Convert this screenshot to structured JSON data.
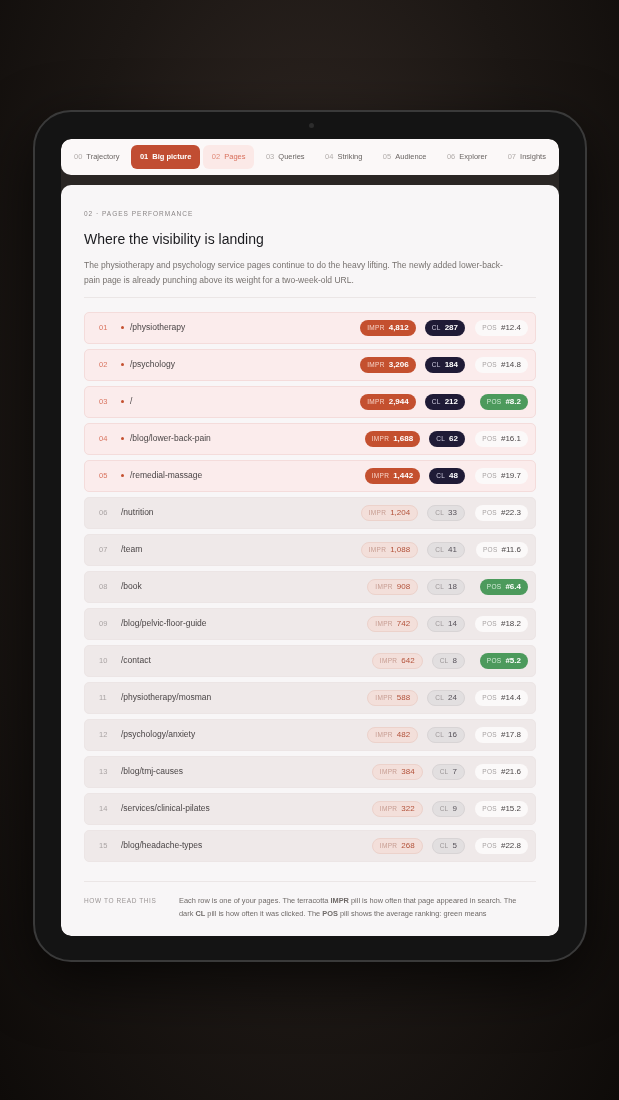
{
  "tabs": [
    {
      "number": "00",
      "label": "Trajectory",
      "selected": false,
      "current": false
    },
    {
      "number": "01",
      "label": "Big picture",
      "selected": true,
      "current": false
    },
    {
      "number": "02",
      "label": "Pages",
      "selected": false,
      "current": true
    },
    {
      "number": "03",
      "label": "Queries",
      "selected": false,
      "current": false
    },
    {
      "number": "04",
      "label": "Striking",
      "selected": false,
      "current": false
    },
    {
      "number": "05",
      "label": "Audience",
      "selected": false,
      "current": false
    },
    {
      "number": "06",
      "label": "Explorer",
      "selected": false,
      "current": false
    },
    {
      "number": "07",
      "label": "Insights",
      "selected": false,
      "current": false
    }
  ],
  "section": {
    "eyebrow": "02 · PAGES PERFORMANCE",
    "title": "Where the visibility is landing",
    "description": "The physiotherapy and psychology service pages continue to do the heavy lifting. The newly added lower-back-pain page is already punching above its weight for a two-week-old URL."
  },
  "rows": [
    {
      "rank": "01",
      "path": "/physiotherapy",
      "highlighted": true,
      "impr": {
        "label": "IMPR",
        "value": "4,812"
      },
      "cl": {
        "label": "CL",
        "value": "287"
      },
      "pos": {
        "label": "POS",
        "value": "#12.4",
        "good": false
      }
    },
    {
      "rank": "02",
      "path": "/psychology",
      "highlighted": true,
      "impr": {
        "label": "IMPR",
        "value": "3,206"
      },
      "cl": {
        "label": "CL",
        "value": "184"
      },
      "pos": {
        "label": "POS",
        "value": "#14.8",
        "good": false
      }
    },
    {
      "rank": "03",
      "path": "/",
      "highlighted": true,
      "impr": {
        "label": "IMPR",
        "value": "2,944"
      },
      "cl": {
        "label": "CL",
        "value": "212"
      },
      "pos": {
        "label": "POS",
        "value": "#8.2",
        "good": true
      }
    },
    {
      "rank": "04",
      "path": "/blog/lower-back-pain",
      "highlighted": true,
      "impr": {
        "label": "IMPR",
        "value": "1,688"
      },
      "cl": {
        "label": "CL",
        "value": "62"
      },
      "pos": {
        "label": "POS",
        "value": "#16.1",
        "good": false
      }
    },
    {
      "rank": "05",
      "path": "/remedial-massage",
      "highlighted": true,
      "impr": {
        "label": "IMPR",
        "value": "1,442"
      },
      "cl": {
        "label": "CL",
        "value": "48"
      },
      "pos": {
        "label": "POS",
        "value": "#19.7",
        "good": false
      }
    },
    {
      "rank": "06",
      "path": "/nutrition",
      "highlighted": false,
      "impr": {
        "label": "IMPR",
        "value": "1,204"
      },
      "cl": {
        "label": "CL",
        "value": "33"
      },
      "pos": {
        "label": "POS",
        "value": "#22.3",
        "good": false
      }
    },
    {
      "rank": "07",
      "path": "/team",
      "highlighted": false,
      "impr": {
        "label": "IMPR",
        "value": "1,088"
      },
      "cl": {
        "label": "CL",
        "value": "41"
      },
      "pos": {
        "label": "POS",
        "value": "#11.6",
        "good": false
      }
    },
    {
      "rank": "08",
      "path": "/book",
      "highlighted": false,
      "impr": {
        "label": "IMPR",
        "value": "908"
      },
      "cl": {
        "label": "CL",
        "value": "18"
      },
      "pos": {
        "label": "POS",
        "value": "#6.4",
        "good": true
      }
    },
    {
      "rank": "09",
      "path": "/blog/pelvic-floor-guide",
      "highlighted": false,
      "impr": {
        "label": "IMPR",
        "value": "742"
      },
      "cl": {
        "label": "CL",
        "value": "14"
      },
      "pos": {
        "label": "POS",
        "value": "#18.2",
        "good": false
      }
    },
    {
      "rank": "10",
      "path": "/contact",
      "highlighted": false,
      "impr": {
        "label": "IMPR",
        "value": "642"
      },
      "cl": {
        "label": "CL",
        "value": "8"
      },
      "pos": {
        "label": "POS",
        "value": "#5.2",
        "good": true
      }
    },
    {
      "rank": "11",
      "path": "/physiotherapy/mosman",
      "highlighted": false,
      "impr": {
        "label": "IMPR",
        "value": "588"
      },
      "cl": {
        "label": "CL",
        "value": "24"
      },
      "pos": {
        "label": "POS",
        "value": "#14.4",
        "good": false
      }
    },
    {
      "rank": "12",
      "path": "/psychology/anxiety",
      "highlighted": false,
      "impr": {
        "label": "IMPR",
        "value": "482"
      },
      "cl": {
        "label": "CL",
        "value": "16"
      },
      "pos": {
        "label": "POS",
        "value": "#17.8",
        "good": false
      }
    },
    {
      "rank": "13",
      "path": "/blog/tmj-causes",
      "highlighted": false,
      "impr": {
        "label": "IMPR",
        "value": "384"
      },
      "cl": {
        "label": "CL",
        "value": "7"
      },
      "pos": {
        "label": "POS",
        "value": "#21.6",
        "good": false
      }
    },
    {
      "rank": "14",
      "path": "/services/clinical-pilates",
      "highlighted": false,
      "impr": {
        "label": "IMPR",
        "value": "322"
      },
      "cl": {
        "label": "CL",
        "value": "9"
      },
      "pos": {
        "label": "POS",
        "value": "#15.2",
        "good": false
      }
    },
    {
      "rank": "15",
      "path": "/blog/headache-types",
      "highlighted": false,
      "impr": {
        "label": "IMPR",
        "value": "268"
      },
      "cl": {
        "label": "CL",
        "value": "5"
      },
      "pos": {
        "label": "POS",
        "value": "#22.8",
        "good": false
      }
    }
  ],
  "footer": {
    "label": "HOW TO READ THIS",
    "text": "Each row is one of your pages. The terracotta **IMPR** pill is how often that page appeared in search. The dark **CL** pill is how often it was clicked. The **POS** pill shows the average ranking: green means"
  }
}
